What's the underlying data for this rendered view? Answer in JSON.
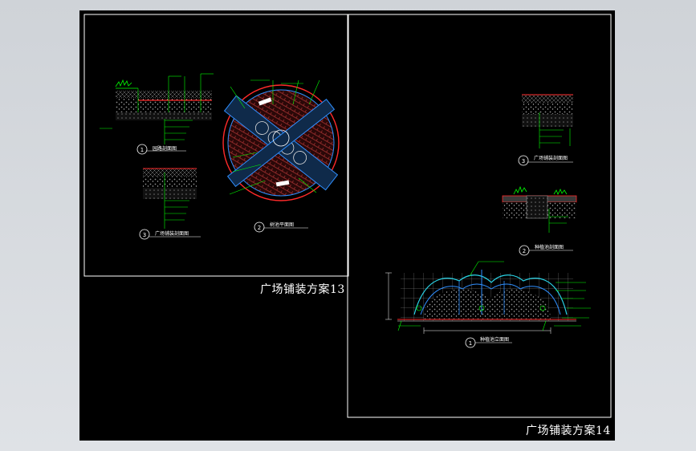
{
  "sheets": [
    {
      "title": "广场铺装方案13",
      "details": [
        {
          "num": "1",
          "caption": "园路剖面图"
        },
        {
          "num": "2",
          "caption": "树池平面图"
        },
        {
          "num": "3",
          "caption": "广场铺装剖面图"
        }
      ]
    },
    {
      "title": "广场铺装方案14",
      "details": [
        {
          "num": "3",
          "caption": "广场铺装剖面图"
        },
        {
          "num": "2",
          "caption": "种植池剖面图"
        },
        {
          "num": "1",
          "caption": "种植池立面图"
        }
      ]
    }
  ],
  "colors": {
    "canvas": "#000000",
    "frame": "#ffffff",
    "annotation": "#00ff00",
    "section_red": "#ff2a2a",
    "planter_blue": "#2f8fff",
    "elevation_cyan": "#29d3e6",
    "hatch_gray": "#9a9a9a"
  }
}
